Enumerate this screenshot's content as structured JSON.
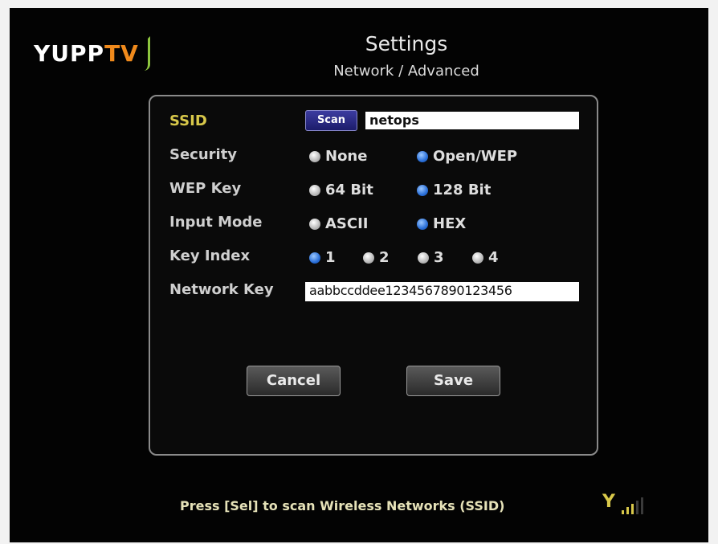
{
  "app": {
    "logo_text_white": "YUPP",
    "logo_text_orange": "TV",
    "title": "Settings",
    "subtitle": "Network / Advanced"
  },
  "form": {
    "ssid": {
      "label": "SSID",
      "scan_label": "Scan",
      "value": "netops"
    },
    "security": {
      "label": "Security",
      "options": [
        "None",
        "Open/WEP"
      ],
      "selected": "Open/WEP"
    },
    "wep_key": {
      "label": "WEP Key",
      "options": [
        "64 Bit",
        "128 Bit"
      ],
      "selected": "128 Bit"
    },
    "input_mode": {
      "label": "Input Mode",
      "options": [
        "ASCII",
        "HEX"
      ],
      "selected": "HEX"
    },
    "key_index": {
      "label": "Key Index",
      "options": [
        "1",
        "2",
        "3",
        "4"
      ],
      "selected": "1"
    },
    "network_key": {
      "label": "Network Key",
      "value": "aabbccddee1234567890123456"
    }
  },
  "buttons": {
    "cancel": "Cancel",
    "save": "Save"
  },
  "footer": {
    "hint": "Press [Sel] to scan Wireless Networks (SSID)",
    "signal_bars_on": 3,
    "signal_bars_total": 5
  },
  "colors": {
    "accent_yellow": "#d8c84a",
    "selected_radio": "#2a6fd8",
    "logo_orange": "#f08a1c",
    "logo_green": "#8ec63f"
  }
}
